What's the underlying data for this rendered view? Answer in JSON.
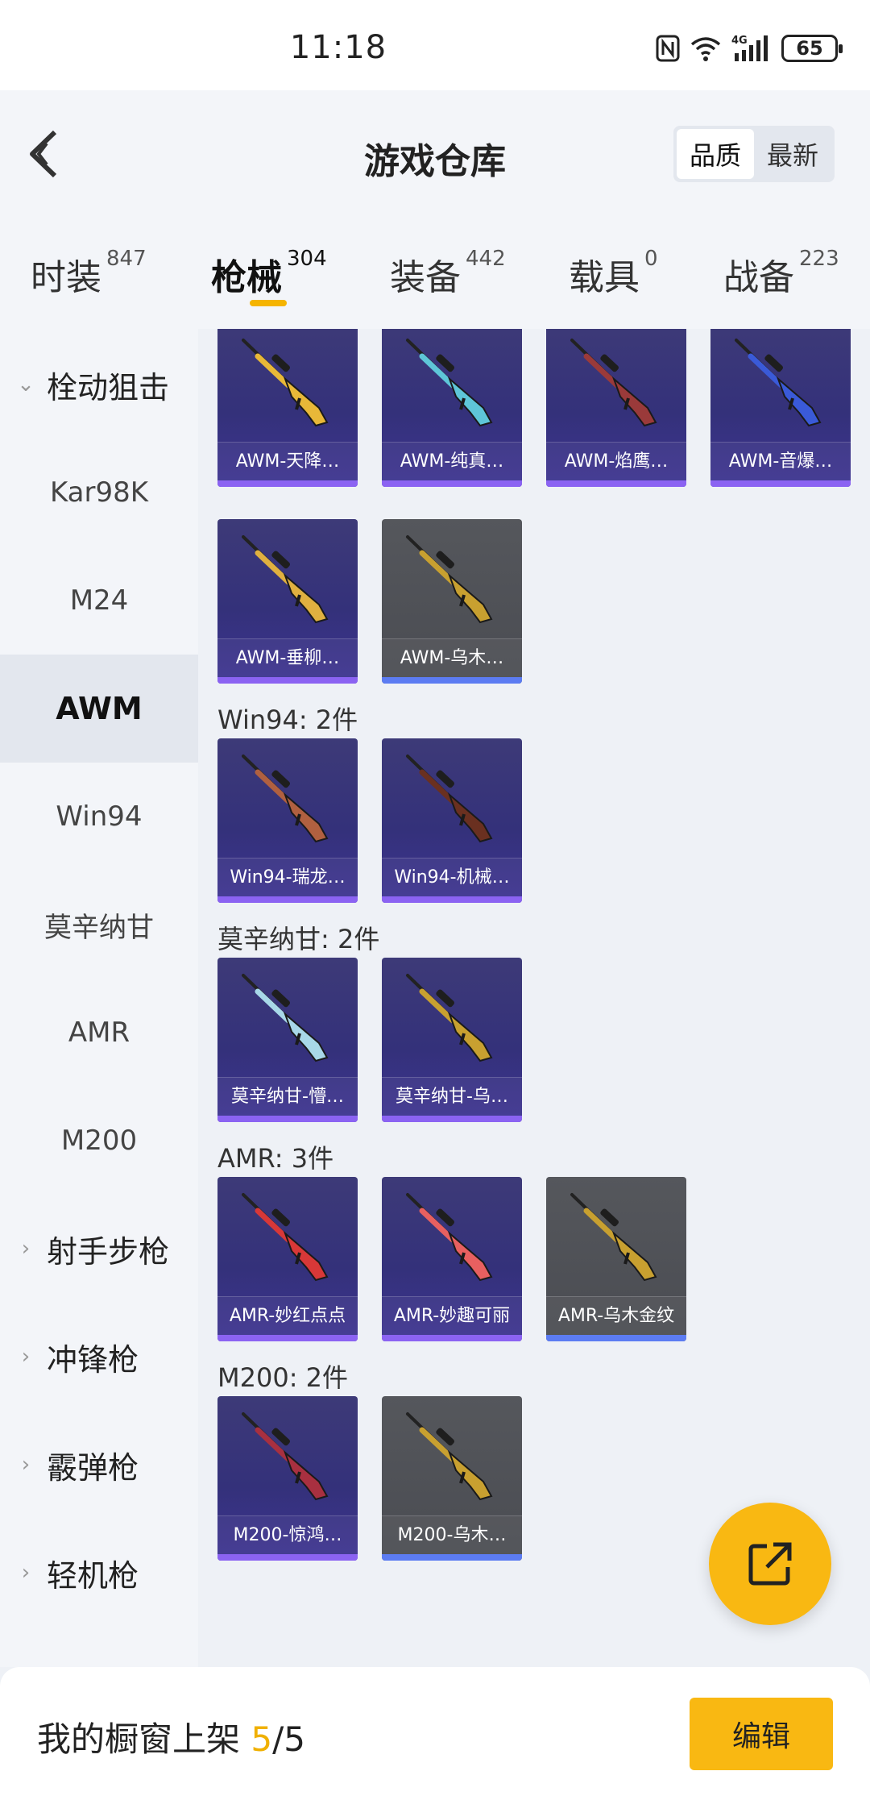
{
  "status_bar": {
    "time": "11:18",
    "battery": "65",
    "network": "4G"
  },
  "header": {
    "title": "游戏仓库",
    "back_icon": "chevron-left-icon",
    "sort_options": [
      {
        "label": "品质",
        "active": true
      },
      {
        "label": "最新",
        "active": false
      }
    ]
  },
  "tabs": [
    {
      "label": "时装",
      "count": "847"
    },
    {
      "label": "枪械",
      "count": "304",
      "active": true
    },
    {
      "label": "装备",
      "count": "442"
    },
    {
      "label": "载具",
      "count": "0"
    },
    {
      "label": "战备",
      "count": "223"
    }
  ],
  "sidebar": {
    "items": [
      {
        "label": "栓动狙击",
        "type": "category",
        "expanded": true
      },
      {
        "label": "Kar98K",
        "type": "sub"
      },
      {
        "label": "M24",
        "type": "sub"
      },
      {
        "label": "AWM",
        "type": "sub",
        "active": true
      },
      {
        "label": "Win94",
        "type": "sub"
      },
      {
        "label": "莫辛纳甘",
        "type": "sub"
      },
      {
        "label": "AMR",
        "type": "sub"
      },
      {
        "label": "M200",
        "type": "sub"
      },
      {
        "label": "射手步枪",
        "type": "category"
      },
      {
        "label": "冲锋枪",
        "type": "category"
      },
      {
        "label": "霰弹枪",
        "type": "category"
      },
      {
        "label": "轻机枪",
        "type": "category"
      }
    ]
  },
  "sections": [
    {
      "heading": "",
      "items": [
        {
          "label": "AWM-天降…",
          "rarity": "purple",
          "gun_color": "#e8b838"
        },
        {
          "label": "AWM-纯真…",
          "rarity": "purple",
          "gun_color": "#5ec6d8"
        },
        {
          "label": "AWM-焰鹰…",
          "rarity": "purple",
          "gun_color": "#9a3a3a"
        },
        {
          "label": "AWM-音爆…",
          "rarity": "purple",
          "gun_color": "#3a5ad8"
        },
        {
          "label": "AWM-垂柳…",
          "rarity": "purple",
          "gun_color": "#e0b040"
        },
        {
          "label": "AWM-乌木…",
          "rarity": "gray",
          "gun_color": "#c8a030"
        }
      ]
    },
    {
      "heading": "Win94: 2件",
      "items": [
        {
          "label": "Win94-瑞龙…",
          "rarity": "purple",
          "gun_color": "#b06040"
        },
        {
          "label": "Win94-机械…",
          "rarity": "purple",
          "gun_color": "#6a3020"
        }
      ]
    },
    {
      "heading": "莫辛纳甘: 2件",
      "items": [
        {
          "label": "莫辛纳甘-懵…",
          "rarity": "purple",
          "gun_color": "#a8d8e8"
        },
        {
          "label": "莫辛纳甘-乌…",
          "rarity": "purple",
          "gun_color": "#c8a030"
        }
      ]
    },
    {
      "heading": "AMR: 3件",
      "items": [
        {
          "label": "AMR-妙红点点",
          "rarity": "purple",
          "gun_color": "#d83838"
        },
        {
          "label": "AMR-妙趣可丽",
          "rarity": "purple",
          "gun_color": "#e86060"
        },
        {
          "label": "AMR-乌木金纹",
          "rarity": "gray",
          "gun_color": "#c8a030"
        }
      ]
    },
    {
      "heading": "M200: 2件",
      "items": [
        {
          "label": "M200-惊鸿…",
          "rarity": "purple",
          "gun_color": "#a83040"
        },
        {
          "label": "M200-乌木…",
          "rarity": "gray",
          "gun_color": "#c8a030"
        }
      ]
    }
  ],
  "fab": {
    "icon": "share-external-icon"
  },
  "bottom_bar": {
    "prefix": "我的橱窗上架 ",
    "current": "5",
    "total": "/5",
    "edit_label": "编辑"
  },
  "colors": {
    "accent": "#f9b812",
    "purple_card": "#3a3678",
    "gray_card": "#4e5056"
  }
}
